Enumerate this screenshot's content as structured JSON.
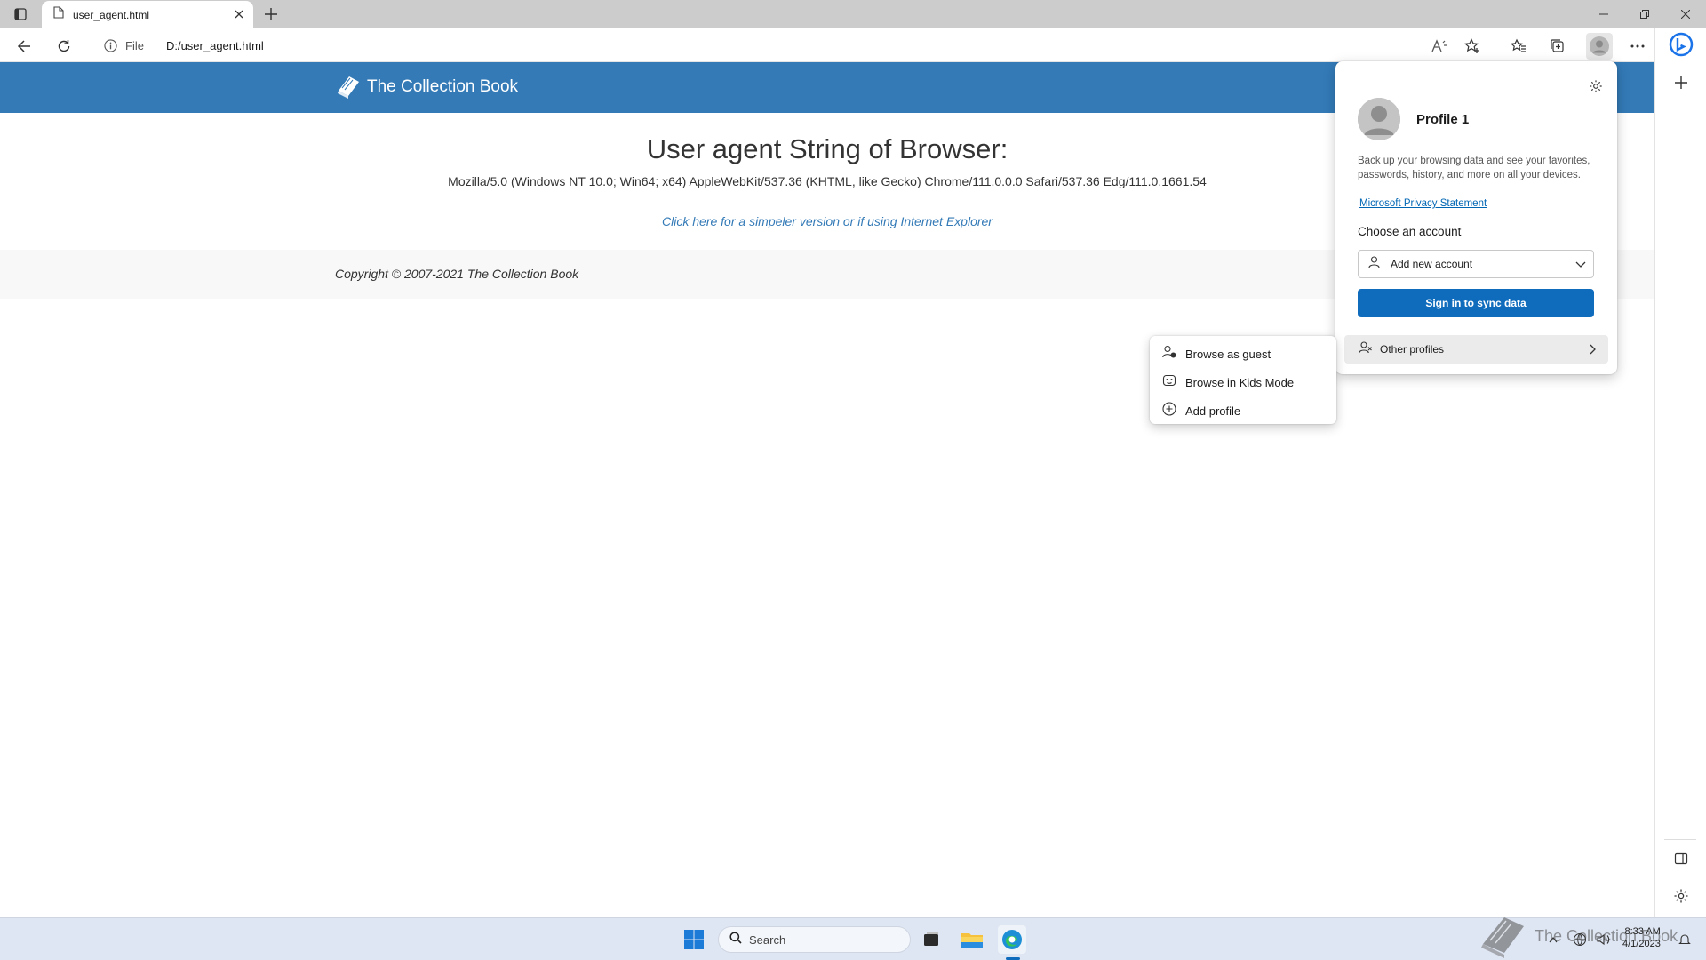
{
  "browser": {
    "tab_title": "user_agent.html",
    "address_scheme": "File",
    "address_url": "D:/user_agent.html"
  },
  "page": {
    "brand": "The Collection Book",
    "heading": "User agent String of Browser:",
    "user_agent": "Mozilla/5.0 (Windows NT 10.0; Win64; x64) AppleWebKit/537.36 (KHTML, like Gecko) Chrome/111.0.0.0 Safari/537.36 Edg/111.0.1661.54",
    "simple_link": "Click here for a simpeler version or if using Internet Explorer",
    "copyright": "Copyright © 2007-2021 The Collection Book"
  },
  "profile_flyout": {
    "profile_name": "Profile 1",
    "description": "Back up your browsing data and see your favorites, passwords, history, and more on all your devices.",
    "privacy_link": "Microsoft Privacy Statement",
    "choose_label": "Choose an account",
    "account_select_value": "Add new account",
    "sync_button": "Sign in to sync data",
    "other_profiles": "Other profiles"
  },
  "submenu": {
    "items": [
      {
        "label": "Browse as guest",
        "icon": "guest-icon"
      },
      {
        "label": "Browse in Kids Mode",
        "icon": "kids-mode-icon"
      },
      {
        "label": "Add profile",
        "icon": "add-circle-icon"
      }
    ]
  },
  "taskbar": {
    "search_placeholder": "Search",
    "time": "8:33 AM",
    "date": "4/1/2023"
  },
  "watermark": {
    "text": "The Collection Book"
  },
  "colors": {
    "header_blue": "#337ab7",
    "sync_button": "#0f6cbd",
    "link": "#337ab7"
  }
}
